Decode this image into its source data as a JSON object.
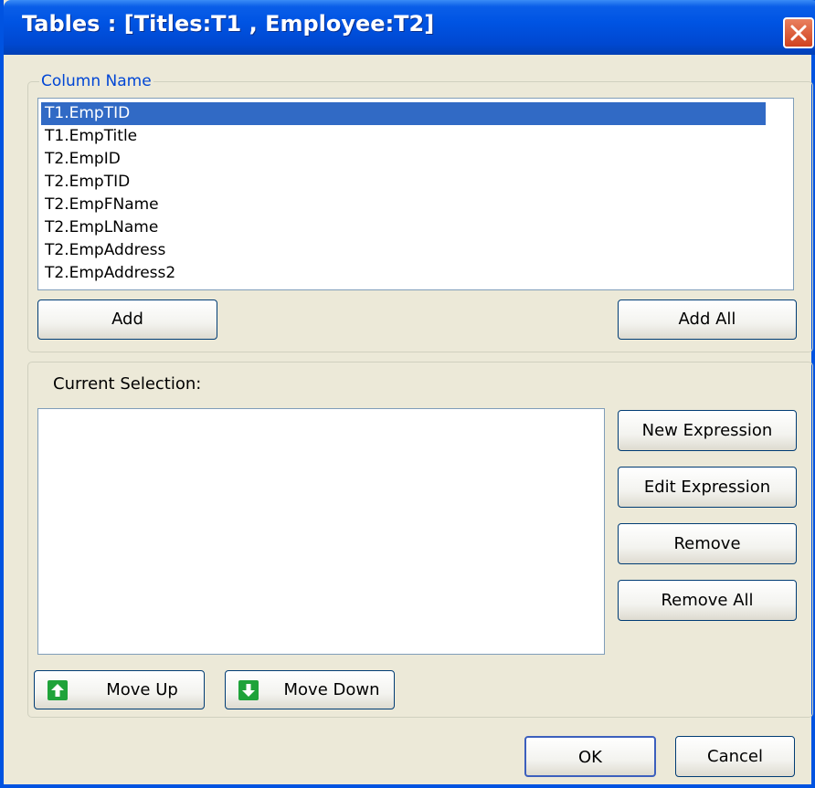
{
  "window": {
    "title": "Tables : [Titles:T1 , Employee:T2]"
  },
  "column_group": {
    "legend": "Column Name",
    "items": [
      "T1.EmpTID",
      "T1.EmpTitle",
      "T2.EmpID",
      "T2.EmpTID",
      "T2.EmpFName",
      "T2.EmpLName",
      "T2.EmpAddress",
      "T2.EmpAddress2"
    ],
    "selected_item": "T1.EmpTID",
    "add_label": "Add",
    "add_all_label": "Add All"
  },
  "selection_group": {
    "label": "Current Selection:",
    "new_expression_label": "New Expression",
    "edit_expression_label": "Edit Expression",
    "remove_label": "Remove",
    "remove_all_label": "Remove All",
    "move_up_label": "Move Up",
    "move_down_label": "Move Down"
  },
  "footer": {
    "ok_label": "OK",
    "cancel_label": "Cancel"
  },
  "colors": {
    "titlebar": "#0054e3",
    "selection": "#316ac5",
    "arrow_icon": "#1fa33a",
    "legend_text": "#0046d5"
  }
}
